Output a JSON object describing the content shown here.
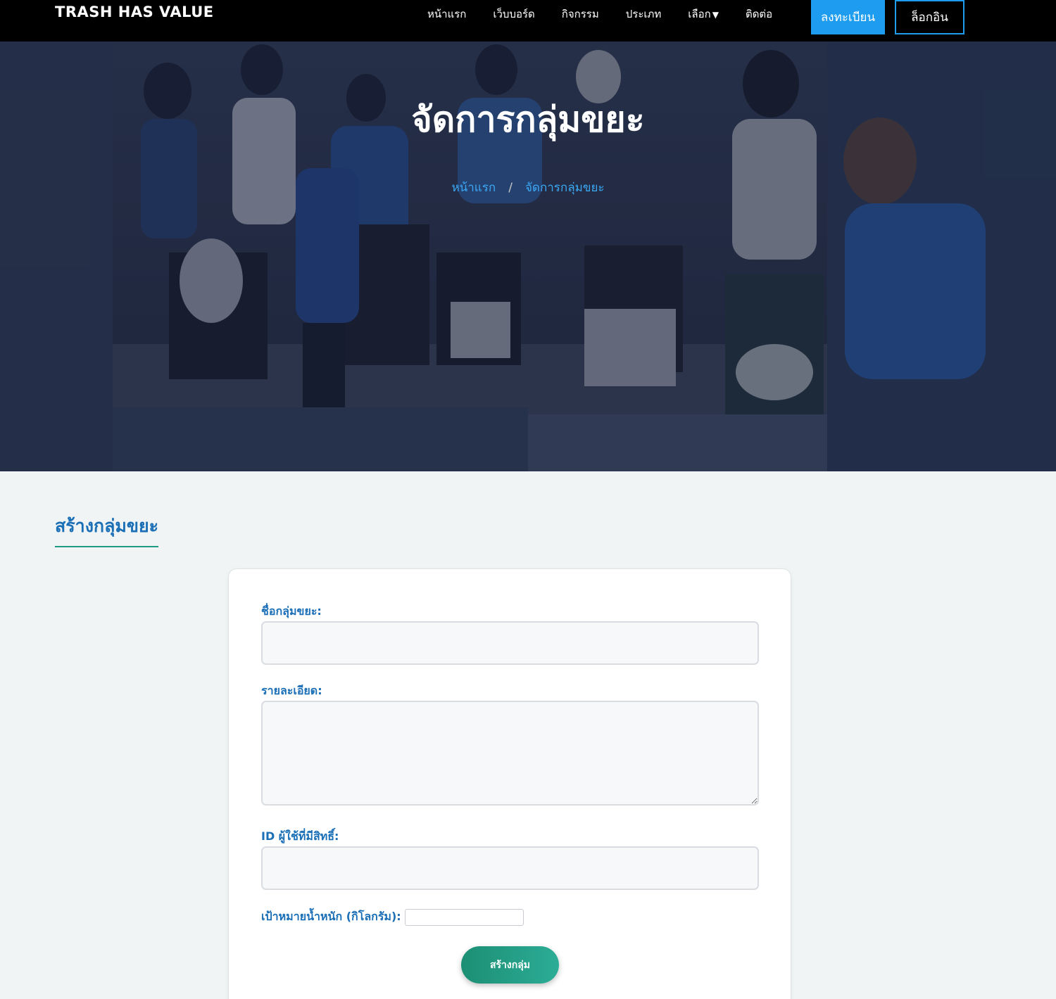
{
  "brand": "TRASH HAS VALUE",
  "nav": {
    "items": [
      "หน้าแรก",
      "เว็บบอร์ด",
      "กิจกรรม",
      "ประเภท",
      "เลือก",
      "ติดต่อ"
    ],
    "register": "ลงทะเบียน",
    "login": "ล็อกอิน"
  },
  "hero": {
    "title": "จัดการกลุ่มขยะ",
    "breadcrumb": {
      "home": "หน้าแรก",
      "separator": "/",
      "current": "จัดการกลุ่มขยะ"
    }
  },
  "section_title": "สร้างกลุ่มขยะ",
  "form": {
    "group_name_label": "ชื่อกลุ่มขยะ:",
    "group_name_value": "",
    "details_label": "รายละเอียด:",
    "details_value": "",
    "user_id_label": "ID ผู้ใช้ที่มีสิทธิ์:",
    "user_id_value": "",
    "weight_label": "เป้าหมายน้ำหนัก (กิโลกรัม):",
    "weight_value": "",
    "submit_label": "สร้างกลุ่ม"
  },
  "colors": {
    "accent_blue": "#1e9cf0",
    "heading_blue": "#1b6fb6",
    "submit_green": "#1c8f74",
    "navbar_bg": "#000000"
  }
}
